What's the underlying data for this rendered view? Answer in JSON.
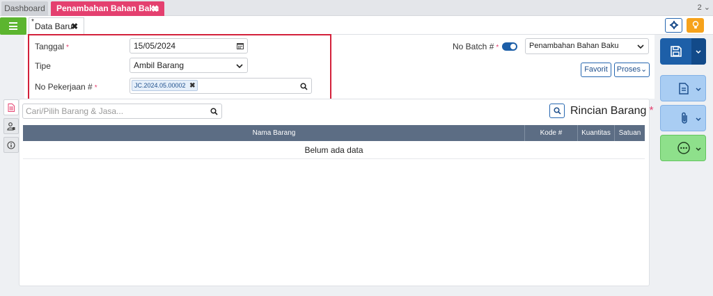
{
  "tabs": {
    "dashboard": "Dashboard",
    "active": "Penambahan Bahan Baku",
    "close": "✖",
    "count": "2 ⌄"
  },
  "subtab": {
    "star": "*",
    "label": "Data Baru",
    "close": "✖"
  },
  "form": {
    "tanggal_label": "Tanggal",
    "tanggal_value": "15/05/2024",
    "tipe_label": "Tipe",
    "tipe_value": "Ambil Barang",
    "pekerjaan_label": "No Pekerjaan #",
    "pekerjaan_chip": "JC.2024.05.00002",
    "required_mark": "*",
    "batch_label": "No Batch #",
    "batch_select": "Penambahan Bahan Baku",
    "favorit": "Favorit",
    "proses": "Proses⌄"
  },
  "items": {
    "search_placeholder": "Cari/Pilih Barang & Jasa...",
    "title": "Rincian Barang",
    "columns": [
      "Nama Barang",
      "Kode #",
      "Kuantitas",
      "Satuan"
    ],
    "empty": "Belum ada data"
  },
  "colors": {
    "accent_pink": "#e4406f",
    "primary_blue": "#1d5fa8",
    "green": "#5cb52f",
    "header_slate": "#5c6d84",
    "highlight_red": "#d3203a"
  },
  "icons": [
    "list-icon",
    "gear-icon",
    "lightbulb-icon",
    "calendar-icon",
    "chevron-down-icon",
    "search-icon",
    "save-icon",
    "document-icon",
    "paperclip-icon",
    "more-icon",
    "info-icon"
  ]
}
